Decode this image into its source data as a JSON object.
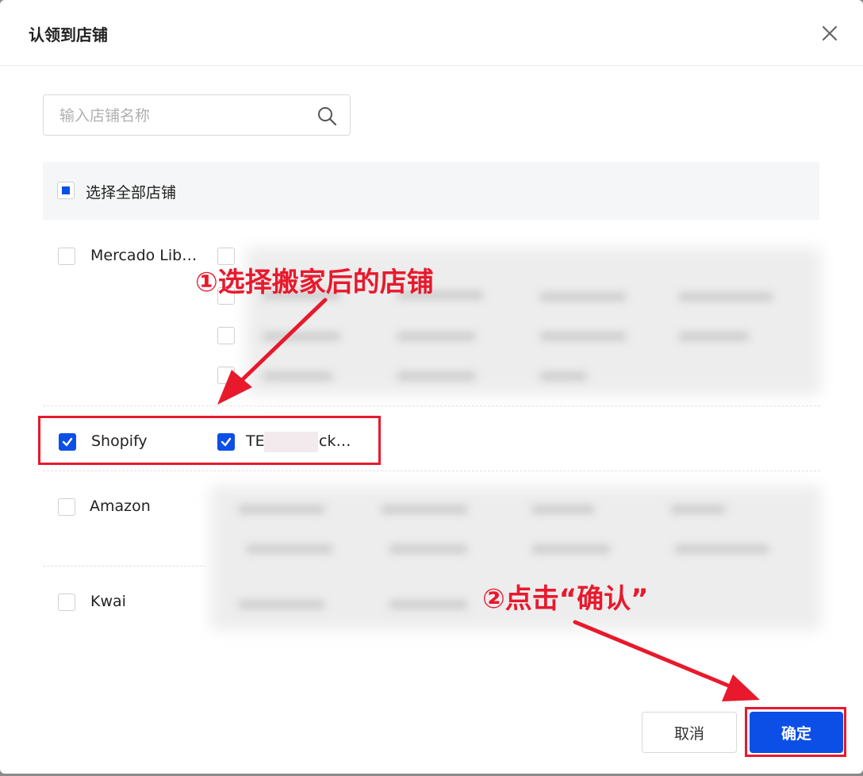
{
  "dialog": {
    "title": "认领到店铺",
    "search_placeholder": "输入店铺名称",
    "select_all_label": "选择全部店铺",
    "platforms": [
      {
        "name": "Mercado Lib…",
        "checked": false
      },
      {
        "name": "Shopify",
        "checked": true,
        "stores": [
          {
            "name_prefix": "TE",
            "name_suffix": "ck…",
            "checked": true
          }
        ]
      },
      {
        "name": "Amazon",
        "checked": false
      },
      {
        "name": "Kwai",
        "checked": false
      }
    ],
    "cancel_label": "取消",
    "confirm_label": "确定"
  },
  "annotations": {
    "step1": "①选择搬家后的店铺",
    "step2": "②点击“确认”"
  },
  "colors": {
    "primary": "#0b4fe6",
    "annotation_red": "#e8192c"
  }
}
